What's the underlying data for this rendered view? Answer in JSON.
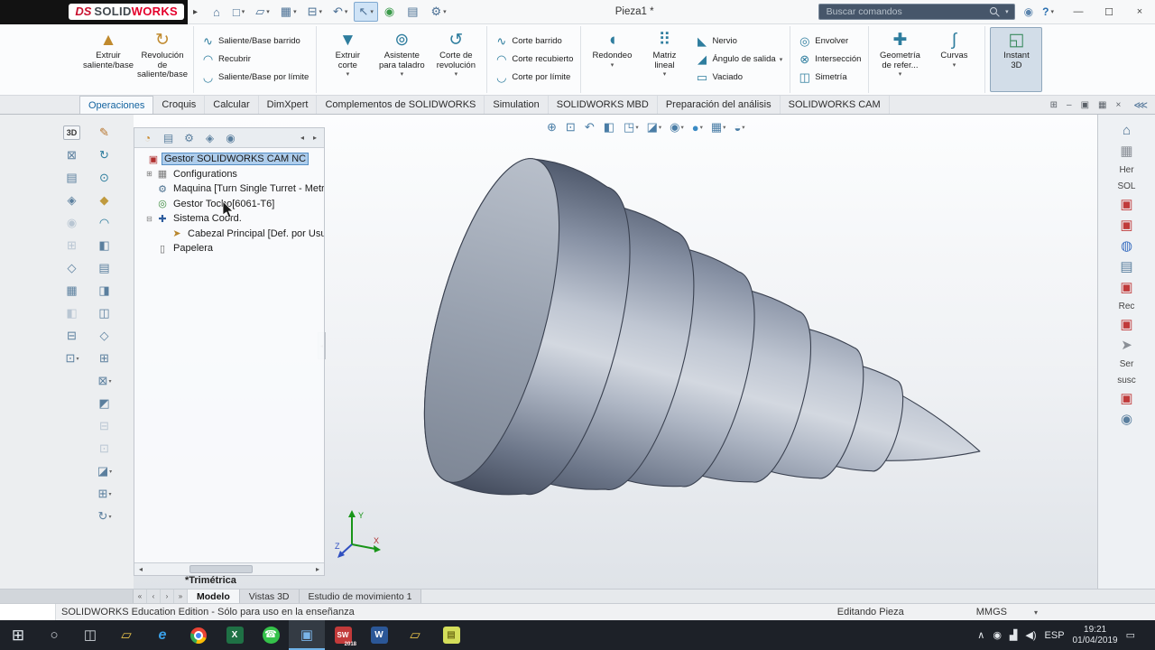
{
  "titlebar": {
    "logo": {
      "ds": "DS",
      "solid": "SOLID",
      "works": "WORKS"
    },
    "menu_arrow": "▸",
    "title": "Pieza1 *",
    "search": {
      "placeholder": "Buscar comandos",
      "arrow": "▾"
    },
    "icons": [
      {
        "name": "user-account-icon",
        "glyph": "◉",
        "ics": "color:#5b84ad"
      },
      {
        "name": "help-button",
        "glyph": "?",
        "arrow": "▾",
        "ics": "color:#2a6fb0;font-weight:bold"
      }
    ],
    "window_controls": [
      {
        "name": "minimize-button",
        "glyph": "—"
      },
      {
        "name": "restore-button",
        "glyph": "☐"
      },
      {
        "name": "close-button",
        "glyph": "×"
      }
    ],
    "quickbar": [
      {
        "name": "home-button",
        "glyph": "⌂"
      },
      {
        "name": "new-document-button",
        "glyph": "□",
        "arrow": "▾"
      },
      {
        "name": "open-document-button",
        "glyph": "▱",
        "arrow": "▾"
      },
      {
        "name": "save-button",
        "glyph": "▦",
        "arrow": "▾"
      },
      {
        "name": "print-button",
        "glyph": "⊟",
        "arrow": "▾"
      },
      {
        "name": "undo-button",
        "glyph": "↶",
        "arrow": "▾"
      },
      {
        "name": "select-button",
        "glyph": "↖",
        "arrow": "▾",
        "mod": "sel"
      },
      {
        "name": "selection-filter-button",
        "glyph": "◉",
        "ics": "color:#3a9a4a"
      },
      {
        "name": "task-list-button",
        "glyph": "▤"
      },
      {
        "name": "options-button",
        "glyph": "⚙",
        "arrow": "▾"
      }
    ]
  },
  "ribbon": {
    "g1": [
      {
        "name": "extrude-boss-button",
        "glyph": "▲",
        "ics": "color:#c08a2e",
        "label": "Extruir\nsaliente/base",
        "arrow": ""
      },
      {
        "name": "revolve-boss-button",
        "glyph": "↻",
        "ics": "color:#c08a2e",
        "label": "Revolución de\nsaliente/base",
        "arrow": ""
      }
    ],
    "g2": [
      {
        "name": "swept-boss-button",
        "glyph": "∿",
        "label": "Saliente/Base barrido"
      },
      {
        "name": "lofted-boss-button",
        "glyph": "◠",
        "label": "Recubrir"
      },
      {
        "name": "boundary-boss-button",
        "glyph": "◡",
        "label": "Saliente/Base por límite"
      }
    ],
    "g3": [
      {
        "name": "extruded-cut-button",
        "glyph": "▼",
        "label": "Extruir\ncorte",
        "arrow": "▾"
      },
      {
        "name": "hole-wizard-button",
        "glyph": "⊚",
        "label": "Asistente\npara taladro",
        "arrow": "▾"
      },
      {
        "name": "revolved-cut-button",
        "glyph": "↺",
        "label": "Corte de\nrevolución",
        "arrow": "▾"
      }
    ],
    "g4": [
      {
        "name": "swept-cut-button",
        "glyph": "∿",
        "label": "Corte barrido"
      },
      {
        "name": "lofted-cut-button",
        "glyph": "◠",
        "label": "Corte recubierto"
      },
      {
        "name": "boundary-cut-button",
        "glyph": "◡",
        "label": "Corte por límite"
      }
    ],
    "g5_large": [
      {
        "name": "fillet-button",
        "glyph": "◖",
        "label": "Redondeo",
        "arrow": "▾"
      },
      {
        "name": "linear-pattern-button",
        "glyph": "⠿",
        "label": "Matriz\nlineal",
        "arrow": "▾"
      }
    ],
    "g5_small": [
      {
        "name": "rib-button",
        "glyph": "◣",
        "label": "Nervio"
      },
      {
        "name": "draft-button",
        "glyph": "◢",
        "label": "Ángulo de salida",
        "arrow": "▾"
      },
      {
        "name": "shell-button",
        "glyph": "▭",
        "label": "Vaciado"
      }
    ],
    "g6": [
      {
        "name": "wrap-button",
        "glyph": "◎",
        "label": "Envolver"
      },
      {
        "name": "intersect-button",
        "glyph": "⊗",
        "label": "Intersección"
      },
      {
        "name": "mirror-button",
        "glyph": "◫",
        "label": "Simetría"
      }
    ],
    "g7": [
      {
        "name": "reference-geometry-button",
        "glyph": "✚",
        "label": "Geometría\nde refer...",
        "arrow": "▾"
      },
      {
        "name": "curves-button",
        "glyph": "∫",
        "label": "Curvas",
        "arrow": "▾"
      }
    ],
    "g8": [
      {
        "name": "instant-3d-button",
        "glyph": "◱",
        "ics": "color:#3a8a5e",
        "label": "Instant\n3D",
        "mod": "active"
      }
    ]
  },
  "tabs": {
    "items": [
      {
        "name": "tab-operaciones",
        "label": "Operaciones",
        "mod": "active"
      },
      {
        "name": "tab-croquis",
        "label": "Croquis"
      },
      {
        "name": "tab-calcular",
        "label": "Calcular"
      },
      {
        "name": "tab-dimxpert",
        "label": "DimXpert"
      },
      {
        "name": "tab-complementos",
        "label": "Complementos de SOLIDWORKS"
      },
      {
        "name": "tab-simulation",
        "label": "Simulation"
      },
      {
        "name": "tab-solidworks-mbd",
        "label": "SOLIDWORKS MBD"
      },
      {
        "name": "tab-preparacion-analisis",
        "label": "Preparación del análisis"
      },
      {
        "name": "tab-solidworks-cam",
        "label": "SOLIDWORKS CAM"
      }
    ],
    "right_icons": [
      {
        "name": "viewport-split-button",
        "glyph": "⊞"
      },
      {
        "name": "document-minimize-button",
        "glyph": "–"
      },
      {
        "name": "document-restore-button",
        "glyph": "▣"
      },
      {
        "name": "document-tile-button",
        "glyph": "▦"
      },
      {
        "name": "document-close-button",
        "glyph": "×"
      }
    ],
    "collapse_glyph": "⋘"
  },
  "strip_a": [
    {
      "name": "view-3d-button",
      "glyph": "3D",
      "mod": "txt"
    },
    {
      "name": "standard-views-button",
      "glyph": "⊠"
    },
    {
      "name": "section-tool-button",
      "glyph": "▤"
    },
    {
      "name": "display-tool-button",
      "glyph": "◈"
    },
    {
      "name": "tool-a5",
      "glyph": "◉",
      "mod": "dim"
    },
    {
      "name": "tool-a6",
      "glyph": "⊞",
      "mod": "dim"
    },
    {
      "name": "tool-a7",
      "glyph": "◇"
    },
    {
      "name": "tool-a8",
      "glyph": "▦"
    },
    {
      "name": "tool-a9",
      "glyph": "◧",
      "mod": "dim"
    },
    {
      "name": "tool-a10",
      "glyph": "⊟"
    },
    {
      "name": "tool-a11",
      "glyph": "⊡",
      "arrow": "▾"
    }
  ],
  "strip_b": [
    {
      "name": "sketch-button",
      "glyph": "✎",
      "ics": "color:#b8762e"
    },
    {
      "name": "tool-b2",
      "glyph": "↻",
      "ics": "color:#2e7d9e"
    },
    {
      "name": "tool-b3",
      "glyph": "⊙",
      "ics": "color:#2e7d9e"
    },
    {
      "name": "tool-b4",
      "glyph": "◆",
      "ics": "color:#c09a3e"
    },
    {
      "name": "tool-b5",
      "glyph": "◠",
      "ics": "color:#2e7d9e"
    },
    {
      "name": "tool-b6",
      "glyph": "◧"
    },
    {
      "name": "tool-b7",
      "glyph": "▤"
    },
    {
      "name": "tool-b8",
      "glyph": "◨"
    },
    {
      "name": "tool-b9",
      "glyph": "◫"
    },
    {
      "name": "tool-b10",
      "glyph": "◇"
    },
    {
      "name": "tool-b11",
      "glyph": "⊞"
    },
    {
      "name": "tool-b12",
      "glyph": "⊠",
      "arrow": "▾"
    },
    {
      "name": "tool-b13",
      "glyph": "◩"
    },
    {
      "name": "tool-b14",
      "glyph": "⊟",
      "mod": "dim"
    },
    {
      "name": "tool-b15",
      "glyph": "⊡",
      "mod": "dim"
    },
    {
      "name": "tool-b16",
      "glyph": "◪",
      "arrow": "▾"
    },
    {
      "name": "tool-b17",
      "glyph": "⊞",
      "arrow": "▾"
    },
    {
      "name": "tool-b18",
      "glyph": "↻",
      "arrow": "▾"
    }
  ],
  "feature_manager": {
    "tabs": [
      {
        "name": "featuremanager-tab",
        "glyph": "◔",
        "ics": "color:#c8892e"
      },
      {
        "name": "propertymanager-tab",
        "glyph": "▤"
      },
      {
        "name": "configurationmanager-tab",
        "glyph": "⚙"
      },
      {
        "name": "dimxpertmanager-tab",
        "glyph": "◈"
      },
      {
        "name": "displaymanager-tab",
        "glyph": "◉"
      }
    ],
    "arrows": {
      "left": "◂",
      "right": "▸"
    },
    "items": [
      {
        "name": "tree-item-cam-manager",
        "label": "Gestor SOLIDWORKS CAM NC",
        "icon_glyph": "▣",
        "ics": "color:#b03030",
        "expander": "",
        "ind": "",
        "mod": "selected"
      },
      {
        "name": "tree-item-configurations",
        "label": "Configurations",
        "icon_glyph": "▦",
        "ics": "color:#7a7a7a",
        "expander": "⊞",
        "ind": "padding-left:10px"
      },
      {
        "name": "tree-item-maquina",
        "label": "Maquina [Turn Single Turret - Metr",
        "icon_glyph": "⚙",
        "ics": "color:#4a6f8e",
        "expander": "",
        "ind": "padding-left:10px"
      },
      {
        "name": "tree-item-gestor-tocho",
        "label": "Gestor Tocho[6061-T6]",
        "icon_glyph": "◎",
        "ics": "color:#3a8a3a",
        "expander": "",
        "ind": "padding-left:10px"
      },
      {
        "name": "tree-item-sistema-coord",
        "label": "Sistema Coord.",
        "icon_glyph": "✚",
        "ics": "color:#2e5d9e",
        "expander": "⊟",
        "ind": "padding-left:10px"
      },
      {
        "name": "tree-item-cabezal-principal",
        "label": "Cabezal Principal [Def. por Usua",
        "icon_glyph": "➤",
        "ics": "color:#b8862e",
        "expander": "",
        "ind": "padding-left:26px"
      },
      {
        "name": "tree-item-papelera",
        "label": "Papelera",
        "icon_glyph": "▯",
        "ics": "color:#6a6a6a",
        "expander": "",
        "ind": "padding-left:10px"
      }
    ],
    "scrollbar": {
      "left": "◂",
      "right": "▸"
    }
  },
  "viewport": {
    "toolbar": [
      {
        "name": "zoom-fit-button",
        "glyph": "⊕"
      },
      {
        "name": "zoom-area-button",
        "glyph": "⊡"
      },
      {
        "name": "previous-view-button",
        "glyph": "↶"
      },
      {
        "name": "section-view-button",
        "glyph": "◧"
      },
      {
        "name": "view-orientation-button",
        "glyph": "◳",
        "arrow": "▾"
      },
      {
        "name": "display-style-button",
        "glyph": "◪",
        "arrow": "▾"
      },
      {
        "name": "hide-show-items-button",
        "glyph": "◉",
        "arrow": "▾"
      },
      {
        "name": "edit-appearance-button",
        "glyph": "●",
        "ics": "color:#3a8ac4",
        "arrow": "▾"
      },
      {
        "name": "apply-scene-button",
        "glyph": "▦",
        "arrow": "▾"
      },
      {
        "name": "view-settings-button",
        "glyph": "◒",
        "arrow": "▾"
      }
    ],
    "view_label": "*Trimétrica",
    "triad": {
      "x": "X",
      "y": "Y",
      "z": "Z"
    },
    "splitter_glyph": "◂",
    "part_color_light": "#d3d8e0",
    "part_color_dark": "#434b5c"
  },
  "taskpane": {
    "items": [
      {
        "name": "taskpane-home-icon",
        "glyph": "⌂",
        "ics": "color:#4a6f8e"
      },
      {
        "name": "taskpane-tools-icon",
        "glyph": "▦",
        "ics": "color:#8a8f96"
      },
      {
        "name": "taskpane-label-her",
        "text": "Her"
      },
      {
        "name": "taskpane-label-sol",
        "text": "SOL"
      },
      {
        "name": "taskpane-red-icon-1",
        "glyph": "▣",
        "ics": "color:#c03a3a"
      },
      {
        "name": "taskpane-red-icon-2",
        "glyph": "▣",
        "ics": "color:#c03a3a"
      },
      {
        "name": "taskpane-globe-icon",
        "glyph": "◍",
        "ics": "color:#3a6fc0"
      },
      {
        "name": "taskpane-list-icon",
        "glyph": "▤",
        "ics": "color:#5a7f9e"
      },
      {
        "name": "taskpane-red-icon-3",
        "glyph": "▣",
        "ics": "color:#c03a3a"
      },
      {
        "name": "taskpane-label-rec",
        "text": "Rec"
      },
      {
        "name": "taskpane-red-icon-4",
        "glyph": "▣",
        "ics": "color:#c03a3a"
      },
      {
        "name": "taskpane-pointer-icon",
        "glyph": "➤",
        "ics": "color:#8a8f96"
      },
      {
        "name": "taskpane-label-ser",
        "text": "Ser"
      },
      {
        "name": "taskpane-label-susc",
        "text": "susc"
      },
      {
        "name": "taskpane-red-icon-5",
        "glyph": "▣",
        "ics": "color:#c03a3a"
      },
      {
        "name": "taskpane-community-icon",
        "glyph": "◉",
        "ics": "color:#5a7f9e"
      }
    ]
  },
  "model_tabs": {
    "nav": [
      {
        "name": "scroll-first-button",
        "glyph": "«"
      },
      {
        "name": "scroll-prev-button",
        "glyph": "‹"
      },
      {
        "name": "scroll-next-button",
        "glyph": "›"
      },
      {
        "name": "scroll-last-button",
        "glyph": "»"
      }
    ],
    "tabs": [
      {
        "name": "tab-modelo",
        "label": "Modelo",
        "mod": "active"
      },
      {
        "name": "tab-vistas-3d",
        "label": "Vistas 3D"
      },
      {
        "name": "tab-estudio-movimiento",
        "label": "Estudio de movimiento 1"
      }
    ]
  },
  "statusbar": {
    "left": "SOLIDWORKS Education Edition - Sólo para uso en la enseñanza",
    "editing": "Editando Pieza",
    "units": "MMGS",
    "units_arrow": "▾"
  },
  "taskbar": {
    "items": [
      {
        "name": "start-button",
        "glyph": "⊞",
        "ics": "color:#e6ecf2;font-size:17px"
      },
      {
        "name": "cortana-button",
        "glyph": "○"
      },
      {
        "name": "task-view-button",
        "glyph": "◫"
      },
      {
        "name": "file-explorer-button",
        "glyph": "▱",
        "ics": "color:#e8c34a"
      },
      {
        "name": "edge-button",
        "glyph": "e",
        "ics": "color:#3aa0e8;font-style:italic;font-weight:bold;font-size:16px"
      },
      {
        "name": "chrome-button",
        "glyph": "",
        "mod": "chrome"
      },
      {
        "name": "excel-button",
        "glyph": "X",
        "mod": "sq",
        "ics": "background:#1f7145;color:#fff"
      },
      {
        "name": "whatsapp-button",
        "glyph": "☎",
        "mod": "circ",
        "ics": "background:#35c24a;color:#fff"
      },
      {
        "name": "solidworks-active-button",
        "glyph": "▣",
        "ics": "color:#7ab4e8",
        "mod": "open"
      },
      {
        "name": "solidworks-2018-button",
        "glyph": "SW",
        "sub": "2018",
        "mod": "sq",
        "ics": "background:#c23a3a;color:#fff;font-size:8px"
      },
      {
        "name": "word-button",
        "glyph": "W",
        "mod": "sq",
        "ics": "background:#2b5797;color:#fff"
      },
      {
        "name": "folder-button",
        "glyph": "▱",
        "ics": "color:#e8c34a"
      },
      {
        "name": "sticky-notes-button",
        "glyph": "▤",
        "mod": "sq",
        "ics": "background:#d4de5a;color:#77771a"
      }
    ],
    "tray": [
      {
        "name": "tray-chevron-button",
        "glyph": "∧"
      },
      {
        "name": "tray-contact-icon",
        "glyph": "◉"
      },
      {
        "name": "tray-network-icon",
        "glyph": "▟"
      },
      {
        "name": "tray-volume-icon",
        "glyph": "◀)"
      },
      {
        "name": "tray-language",
        "text": "ESP"
      }
    ],
    "clock": {
      "time": "19:21",
      "date": "01/04/2019"
    },
    "action_glyph": "▭"
  }
}
